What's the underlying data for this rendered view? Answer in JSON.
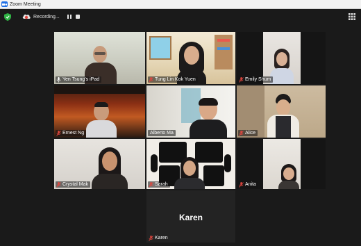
{
  "window": {
    "title": "Zoom Meeting"
  },
  "toolbar": {
    "recording_label": "Recording...",
    "icons": [
      "shield-icon",
      "recording-icon",
      "pause-icon",
      "stop-icon",
      "gallery-grid-icon"
    ]
  },
  "participants": [
    {
      "name": "Yen Tsung's iPad",
      "muted": false,
      "active_speaker": true
    },
    {
      "name": "Tung Lin Kok Yuen",
      "muted": true
    },
    {
      "name": "Emily Shum",
      "muted": true
    },
    {
      "name": "Ernest Ng",
      "muted": true
    },
    {
      "name": "Alberto Ma",
      "muted": false
    },
    {
      "name": "Alice",
      "muted": true
    },
    {
      "name": "Crystal Mak",
      "muted": true
    },
    {
      "name": "Sarah",
      "muted": true
    },
    {
      "name": "Anita",
      "muted": true
    },
    {
      "name": "Karen",
      "muted": true,
      "video_off": true,
      "display_name": "Karen"
    }
  ],
  "colors": {
    "active_border": "#a9e05d",
    "muted_mic": "#e0463e"
  }
}
